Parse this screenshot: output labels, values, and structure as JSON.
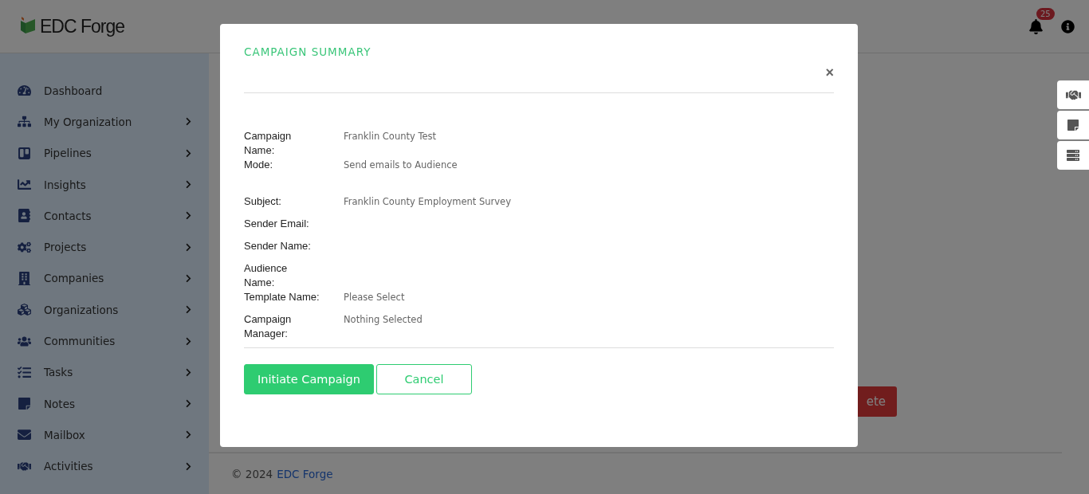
{
  "header": {
    "logo": "EDC Forge",
    "notifications": "25"
  },
  "sidebar": {
    "items": [
      {
        "label": "Dashboard",
        "expandable": false
      },
      {
        "label": "My Organization",
        "expandable": true
      },
      {
        "label": "Pipelines",
        "expandable": true
      },
      {
        "label": "Insights",
        "expandable": true
      },
      {
        "label": "Contacts",
        "expandable": true
      },
      {
        "label": "Projects",
        "expandable": true
      },
      {
        "label": "Companies",
        "expandable": true
      },
      {
        "label": "Organizations",
        "expandable": true
      },
      {
        "label": "Communities",
        "expandable": true
      },
      {
        "label": "Tasks",
        "expandable": true
      },
      {
        "label": "Notes",
        "expandable": true
      },
      {
        "label": "Mailbox",
        "expandable": true
      },
      {
        "label": "Activities",
        "expandable": true
      }
    ]
  },
  "background": {
    "delete_button": "ete"
  },
  "footer": {
    "copyright": "© 2024",
    "link": "EDC Forge"
  },
  "modal": {
    "title": "CAMPAIGN SUMMARY",
    "close": "×",
    "fields": [
      {
        "label": "Campaign Name:",
        "value": "Franklin County Test"
      },
      {
        "label": "Mode:",
        "value": "Send emails to Audience",
        "gap_after": true
      },
      {
        "label": "Subject:",
        "value": "Franklin County Employment Survey"
      },
      {
        "label": "Sender Email:"
      },
      {
        "label": "Sender Name:"
      },
      {
        "label": "Audience Name:"
      },
      {
        "label": "Template Name:",
        "value": "Please Select"
      },
      {
        "label": "Campaign Manager:",
        "value": "Nothing Selected"
      }
    ],
    "buttons": [
      {
        "label": "Initiate Campaign",
        "kind": "primary"
      },
      {
        "label": "Cancel",
        "kind": "outline"
      }
    ]
  }
}
